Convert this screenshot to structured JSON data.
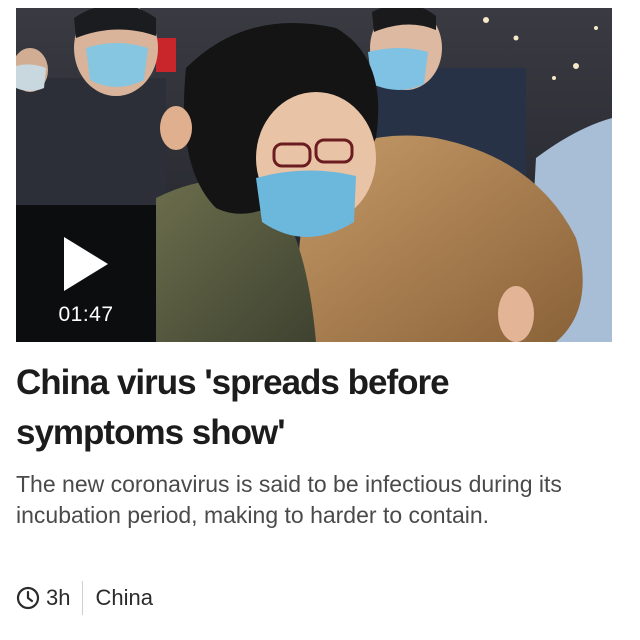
{
  "article": {
    "headline": "China virus 'spreads before symptoms show'",
    "summary": "The new coronavirus is said to be infectious during its incubation period, making to harder to contain.",
    "video": {
      "duration": "01:47",
      "play_icon": "play-icon"
    },
    "meta": {
      "time_icon": "clock-icon",
      "age": "3h",
      "section": "China"
    }
  },
  "colors": {
    "headline": "#1c1c1c",
    "summary": "#4a4a4a",
    "divider": "#cfcfcf",
    "overlay": "#000000"
  }
}
